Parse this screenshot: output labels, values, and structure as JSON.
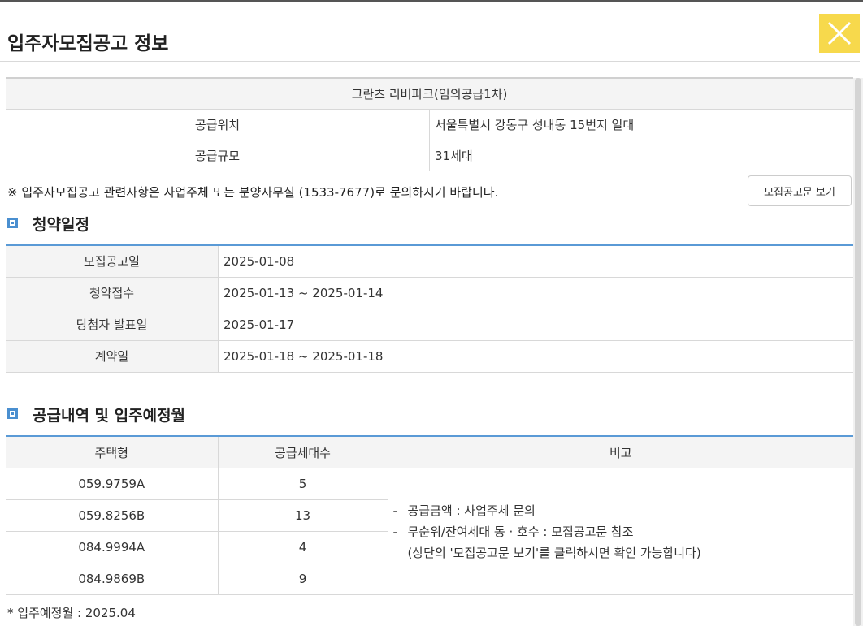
{
  "modal": {
    "title": "입주자모집공고 정보",
    "close_icon": "close-icon"
  },
  "info": {
    "complex_name": "그란츠 리버파크(임의공급1차)",
    "rows": [
      {
        "label": "공급위치",
        "value": "서울특별시 강동구 성내동 15번지 일대"
      },
      {
        "label": "공급규모",
        "value": "31세대"
      }
    ]
  },
  "notice": {
    "text": "※ 입주자모집공고 관련사항은 사업주체 또는 분양사무실 (1533-7677)로 문의하시기 바랍니다.",
    "button_label": "모집공고문 보기"
  },
  "schedule": {
    "title": "청약일정",
    "rows": [
      {
        "label": "모집공고일",
        "value": "2025-01-08"
      },
      {
        "label": "청약접수",
        "value": "2025-01-13 ~ 2025-01-14"
      },
      {
        "label": "당첨자 발표일",
        "value": "2025-01-17"
      },
      {
        "label": "계약일",
        "value": "2025-01-18 ~ 2025-01-18"
      }
    ]
  },
  "supply": {
    "title": "공급내역 및 입주예정월",
    "headers": [
      "주택형",
      "공급세대수",
      "비고"
    ],
    "rows": [
      {
        "type": "059.9759A",
        "count": "5"
      },
      {
        "type": "059.8256B",
        "count": "13"
      },
      {
        "type": "084.9994A",
        "count": "4"
      },
      {
        "type": "084.9869B",
        "count": "9"
      }
    ],
    "notes": {
      "dash": "-",
      "line1": "공급금액 : 사업주체 문의",
      "line2": "무순위/잔여세대 동 · 호수 : 모집공고문 참조",
      "line3": "(상단의 '모집공고문 보기'를 클릭하시면 확인 가능합니다)"
    },
    "move_in": "* 입주예정월 : 2025.04"
  },
  "colors": {
    "accent": "#4a8fd0",
    "close_bg": "#f7d94c"
  }
}
